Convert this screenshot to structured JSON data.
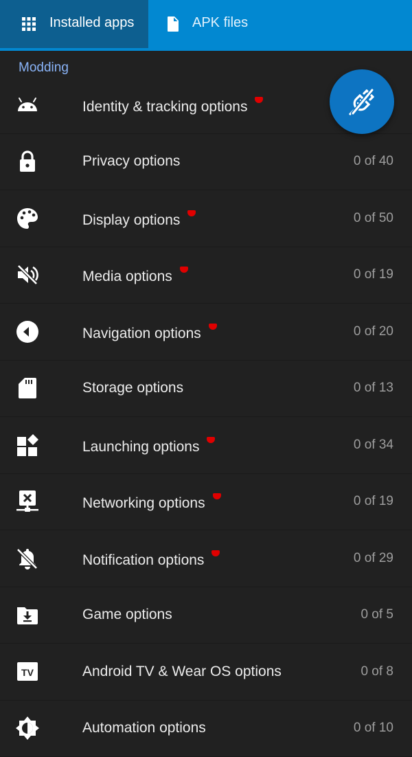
{
  "tabs": [
    {
      "label": "Installed apps",
      "icon": "apps-grid-icon",
      "active": true
    },
    {
      "label": "APK files",
      "icon": "file-icon",
      "active": false
    }
  ],
  "section": {
    "title": "Modding"
  },
  "colors": {
    "accent": "#0288d1",
    "tab_active": "#0d5f90",
    "fab": "#0d74c2",
    "section_title": "#8ab4f8",
    "background": "#212121",
    "badge_dot": "#e00000"
  },
  "options": [
    {
      "label": "Identity & tracking options",
      "count": "",
      "new_badge": true,
      "icon": "android-icon"
    },
    {
      "label": "Privacy options",
      "count": "0 of 40",
      "new_badge": false,
      "icon": "lock-icon"
    },
    {
      "label": "Display options",
      "count": "0 of 50",
      "new_badge": true,
      "icon": "palette-icon"
    },
    {
      "label": "Media options",
      "count": "0 of 19",
      "new_badge": true,
      "icon": "volume-off-icon"
    },
    {
      "label": "Navigation options",
      "count": "0 of 20",
      "new_badge": true,
      "icon": "navigation-back-icon"
    },
    {
      "label": "Storage options",
      "count": "0 of 13",
      "new_badge": false,
      "icon": "sd-card-icon"
    },
    {
      "label": "Launching options",
      "count": "0 of 34",
      "new_badge": true,
      "icon": "widgets-icon"
    },
    {
      "label": "Networking options",
      "count": "0 of 19",
      "new_badge": true,
      "icon": "network-off-icon"
    },
    {
      "label": "Notification options",
      "count": "0 of 29",
      "new_badge": true,
      "icon": "notifications-off-icon"
    },
    {
      "label": "Game options",
      "count": "0 of 5",
      "new_badge": false,
      "icon": "folder-download-icon"
    },
    {
      "label": "Android TV & Wear OS options",
      "count": "0 of 8",
      "new_badge": false,
      "icon": "tv-icon"
    },
    {
      "label": "Automation options",
      "count": "0 of 10",
      "new_badge": false,
      "icon": "brightness-icon"
    }
  ],
  "fab": {
    "icon": "apk-mod-icon"
  }
}
